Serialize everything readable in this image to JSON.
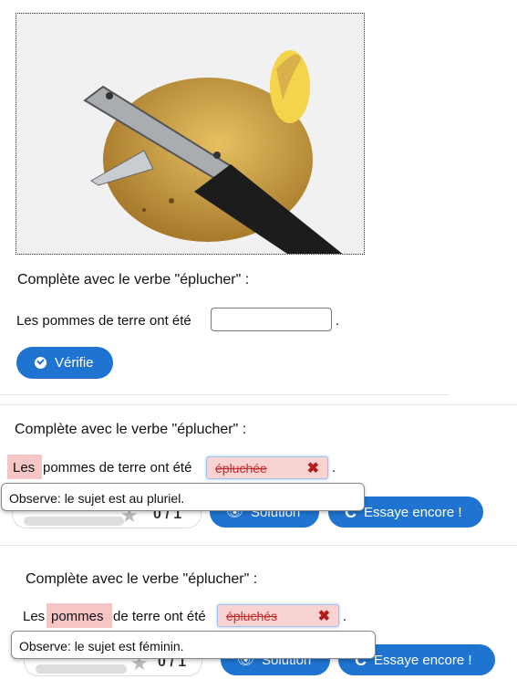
{
  "ex1": {
    "question": "Complète avec le verbe \"éplucher\" :",
    "sentence": "Les pommes de terre ont été",
    "period": ".",
    "input_value": "",
    "check_button": "Vérifie"
  },
  "ex2": {
    "question": "Complète avec le verbe \"éplucher\" :",
    "highlight": "Les",
    "sentence_rest": "pommes de terre ont été",
    "answer": "épluchée",
    "period": ".",
    "tooltip": "Observe: le sujet est au pluriel.",
    "score": "0 / 1",
    "solution_button": "Solution",
    "retry_button": "Essaye encore !"
  },
  "ex3": {
    "question": "Complète avec le verbe \"éplucher\" :",
    "word1": "Les",
    "highlight": "pommes",
    "sentence_rest": "de terre ont été",
    "answer": "épluchés",
    "period": ".",
    "tooltip": "Observe: le sujet est féminin.",
    "score": "0 / 1",
    "solution_button": "Solution",
    "retry_button": "Essaye encore !"
  },
  "colors": {
    "accent": "#1f74d1",
    "error_bg": "#f9d2d2",
    "error_text": "#c32a2a"
  }
}
